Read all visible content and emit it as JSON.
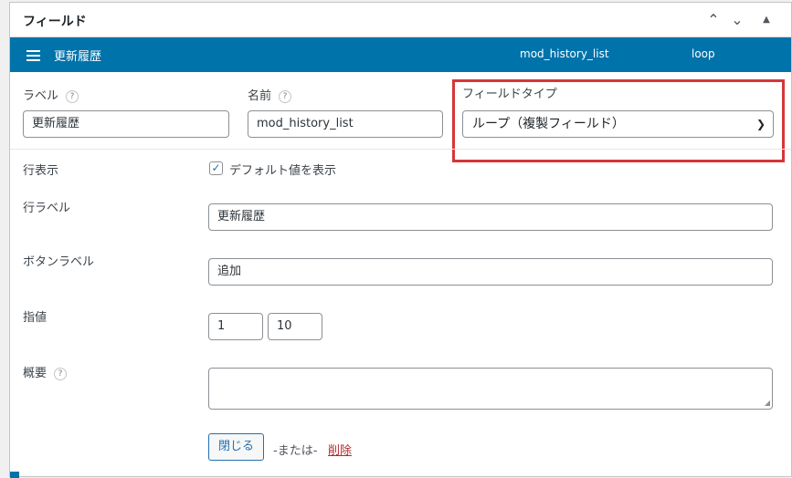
{
  "panel": {
    "title": "フィールド",
    "controls": {
      "up": "⌃",
      "down": "⌄",
      "collapse": "▲"
    }
  },
  "bar": {
    "title": "更新履歴",
    "field_name": "mod_history_list",
    "field_type": "loop"
  },
  "fields": {
    "label": {
      "label": "ラベル",
      "value": "更新履歴"
    },
    "name": {
      "label": "名前",
      "value": "mod_history_list"
    },
    "type": {
      "label": "フィールドタイプ",
      "value": "ループ（複製フィールド）"
    }
  },
  "rows": {
    "row_display": {
      "label": "行表示",
      "checkbox_label": "デフォルト値を表示",
      "checked": true
    },
    "row_label": {
      "label": "行ラベル",
      "value": "更新履歴"
    },
    "button_label": {
      "label": "ボタンラベル",
      "value": "追加"
    },
    "limits": {
      "label": "指値",
      "min": "1",
      "max": "10"
    },
    "summary": {
      "label": "概要",
      "value": ""
    }
  },
  "actions": {
    "close": "閉じる",
    "or": "-または-",
    "delete": "削除"
  },
  "help_glyph": "?",
  "colors": {
    "accent": "#0073aa",
    "highlight": "#d63638",
    "delete": "#b32d2e"
  }
}
